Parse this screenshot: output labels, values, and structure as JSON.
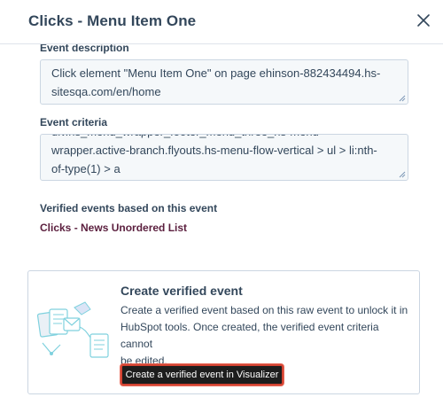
{
  "header": {
    "title": "Clicks - Menu Item One"
  },
  "event_description": {
    "label": "Event description",
    "value_line1": "Click element \"Menu Item One\" on page ehinson-882434494.hs-",
    "value_line2": "sitesqa.com/en/home"
  },
  "event_criteria": {
    "label": "Event criteria",
    "value_line0": "div.hs_menu_wrapper_footer_menu_three_hs-menu-",
    "value_line1": "wrapper.active-branch.flyouts.hs-menu-flow-vertical > ul > li:nth-",
    "value_line2": "of-type(1) > a"
  },
  "verified_events": {
    "label": "Verified events based on this event",
    "link": "Clicks - News Unordered List"
  },
  "create_card": {
    "title": "Create verified event",
    "desc_line1": "Create a verified event based on this raw event to unlock it in",
    "desc_line2": "HubSpot tools. Once created, the verified event criteria cannot",
    "desc_line3": "be edited.",
    "button": "Create a verified event in Visualizer"
  },
  "colors": {
    "text": "#33475b",
    "link": "#5b1f3e",
    "button_bg": "#1d1d1d",
    "button_outline": "#d34332",
    "field_bg": "#f5f8fa"
  }
}
